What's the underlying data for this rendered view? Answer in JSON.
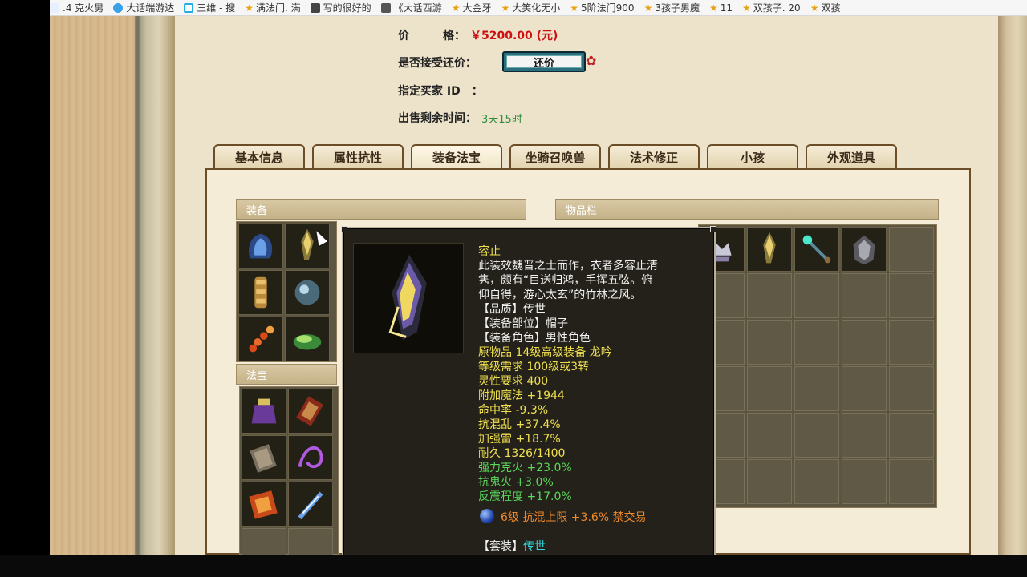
{
  "bookmarks": [
    {
      "label": ".4 克火男",
      "icon": "flame-icon"
    },
    {
      "label": "大话端游达",
      "icon": "game-icon"
    },
    {
      "label": "三维 - 搜",
      "icon": "bilibili-icon"
    },
    {
      "label": "满法门. 满",
      "icon": "star-icon"
    },
    {
      "label": "写的很好的",
      "icon": "page-icon"
    },
    {
      "label": "《大话西游",
      "icon": "page-icon"
    },
    {
      "label": "大金牙",
      "icon": "star-icon"
    },
    {
      "label": "大笑化无小",
      "icon": "star-icon"
    },
    {
      "label": "5阶法门900",
      "icon": "star-icon"
    },
    {
      "label": "3孩子男魔",
      "icon": "star-icon"
    },
    {
      "label": "11",
      "icon": "star-icon"
    },
    {
      "label": "双孩子. 20",
      "icon": "star-icon"
    },
    {
      "label": "双孩",
      "icon": "star-icon"
    }
  ],
  "listing": {
    "price_label": "价　　　格：",
    "price_value": "￥5200.00 (元)",
    "counter_label": "是否接受还价：",
    "counter_button": "还价",
    "buyer_label": "指定买家 ID　：",
    "buyer_value": "",
    "time_label": "出售剩余时间：",
    "time_value": "3天15时"
  },
  "tabs": [
    "基本信息",
    "属性抗性",
    "装备法宝",
    "坐骑召唤兽",
    "法术修正",
    "小孩",
    "外观道具"
  ],
  "active_tab": 2,
  "sections": {
    "equipment": "装备",
    "treasure": "法宝",
    "inventory": "物品栏"
  },
  "equipment_items": [
    "blue-armor-icon",
    "helmet-icon",
    "scroll-bundle-icon",
    "orb-icon",
    "red-beads-icon",
    "green-shoes-icon"
  ],
  "treasure_items": [
    "purple-pouch-icon",
    "red-seal-icon",
    "stone-tablet-icon",
    "purple-ribbon-icon",
    "fire-tablet-icon",
    "blue-sword-icon"
  ],
  "inventory_items": [
    "silver-crown-icon",
    "helmet-icon",
    "staff-icon",
    "mask-icon"
  ],
  "tooltip": {
    "name": "容止",
    "desc": [
      "此装效魏晋之士而作，衣者多容止清",
      "隽，颇有“目送归鸿，手挥五弦。俯",
      "仰自得，游心太玄”的竹林之风。"
    ],
    "quality": "【品质】传世",
    "slot": "【装备部位】帽子",
    "role": "【装备角色】男性角色",
    "origin": "原物品 14级高级装备 龙吟",
    "level_req": "等级需求 100级或3转",
    "spirit_req": "灵性要求 400",
    "stats_yellow": [
      "附加魔法 +1944",
      "命中率 -9.3%",
      "抗混乱 +37.4%",
      "加强雷 +18.7%",
      "耐久 1326/1400"
    ],
    "stats_green": [
      "强力克火 +23.0%",
      "抗鬼火 +3.0%",
      "反震程度 +17.0%"
    ],
    "gem_line": "6级 抗混上限 +3.6% 禁交易",
    "set_label": "【套装】",
    "set_value": "传世"
  },
  "colors": {
    "price": "#cc1111",
    "time": "#2e8b3a",
    "tooltip_bg": "#232119",
    "yellow_text": "#f0e050",
    "green_text": "#5cd85c",
    "orange_text": "#f08a2a",
    "cyan_text": "#33d8e0"
  }
}
